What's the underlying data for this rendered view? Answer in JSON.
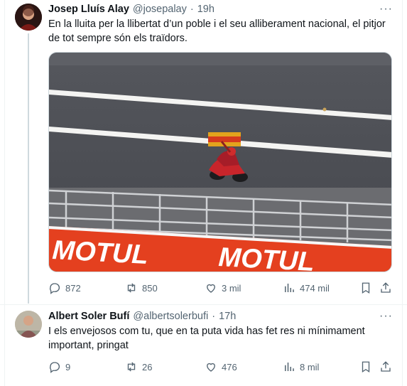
{
  "tweets": [
    {
      "author": "Josep Lluís Alay",
      "handle": "@josepalay",
      "time": "19h",
      "text": "En la lluita per la llibertat d’un poble i el seu alliberament nacional, el pitjor de tot sempre són els traïdors.",
      "media": {
        "banner_text_1": "MOTUL",
        "banner_text_2": "MOTUL"
      },
      "stats": {
        "replies": "872",
        "reposts": "850",
        "likes": "3 mil",
        "views": "474 mil"
      }
    },
    {
      "author": "Albert Soler Bufí",
      "handle": "@albertsolerbufi",
      "time": "17h",
      "text": "I els envejosos com tu, que en ta puta vida has fet res ni mínimament important, pringat",
      "stats": {
        "replies": "9",
        "reposts": "26",
        "likes": "476",
        "views": "8 mil"
      }
    }
  ],
  "separator": "·",
  "more_glyph": "···",
  "icons": {
    "reply": "reply-icon",
    "repost": "repost-icon",
    "like": "heart-icon",
    "views": "views-icon",
    "bookmark": "bookmark-icon",
    "share": "share-icon"
  },
  "colors": {
    "secondary_text": "#536471",
    "banner_red": "#e4401f",
    "track": "#4b4d54"
  }
}
